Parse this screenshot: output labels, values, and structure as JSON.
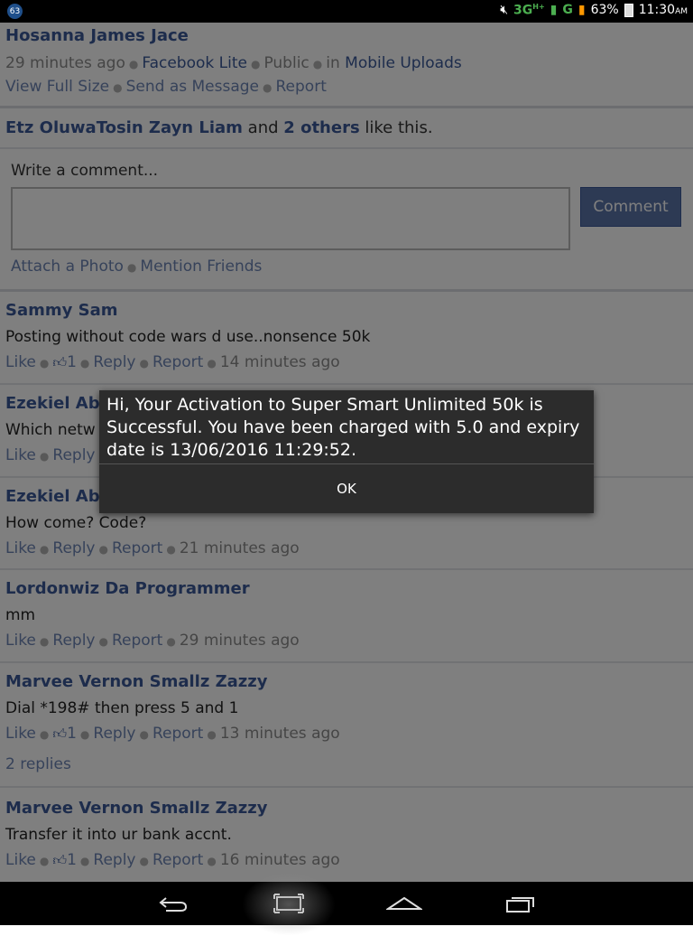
{
  "status_bar": {
    "notification_count": "63",
    "network": "3G",
    "network_sup": "H+",
    "network2": "G",
    "battery": "63%",
    "time": "11:30",
    "ampm": "AM"
  },
  "post": {
    "author": "Hosanna James Jace",
    "time": "29 minutes ago",
    "source": "Facebook Lite",
    "privacy": "Public",
    "in_label": "in",
    "album": "Mobile Uploads",
    "actions": [
      "View Full Size",
      "Send as Message",
      "Report"
    ]
  },
  "likes": {
    "names": "Etz OluwaTosin Zayn Liam",
    "and": "and",
    "others": "2 others",
    "suffix": "like this."
  },
  "composer": {
    "label": "Write a comment...",
    "button": "Comment",
    "attach": "Attach a Photo",
    "mention": "Mention Friends"
  },
  "comments": [
    {
      "name": "Sammy Sam",
      "text": "Posting without code wars d use..nonsence  50k",
      "like": "Like",
      "likes": "1",
      "reply": "Reply",
      "report": "Report",
      "time": "14 minutes ago"
    },
    {
      "name": "Ezekiel Abic",
      "text": "Which netw",
      "like": "Like",
      "likes": "",
      "reply": "Reply",
      "report": "",
      "time": ""
    },
    {
      "name": "Ezekiel Abic",
      "text": "How come? Code?",
      "like": "Like",
      "likes": "",
      "reply": "Reply",
      "report": "Report",
      "time": "21 minutes ago"
    },
    {
      "name": "Lordonwiz Da Programmer",
      "text": "mm",
      "like": "Like",
      "likes": "",
      "reply": "Reply",
      "report": "Report",
      "time": "29 minutes ago"
    },
    {
      "name": "Marvee Vernon Smallz Zazzy",
      "text": "Dial *198#  then press 5 and 1",
      "like": "Like",
      "likes": "1",
      "reply": "Reply",
      "report": "Report",
      "time": "13 minutes ago",
      "replies": "2 replies"
    },
    {
      "name": "Marvee Vernon Smallz Zazzy",
      "text": "Transfer it into ur bank accnt.",
      "like": "Like",
      "likes": "1",
      "reply": "Reply",
      "report": "Report",
      "time": "16 minutes ago"
    }
  ],
  "dialog": {
    "message": "Hi, Your Activation to Super Smart Unlimited 50k is Successful. You have been charged with 5.0 and expiry date is 13/06/2016 11:29:52.",
    "ok": "OK"
  }
}
